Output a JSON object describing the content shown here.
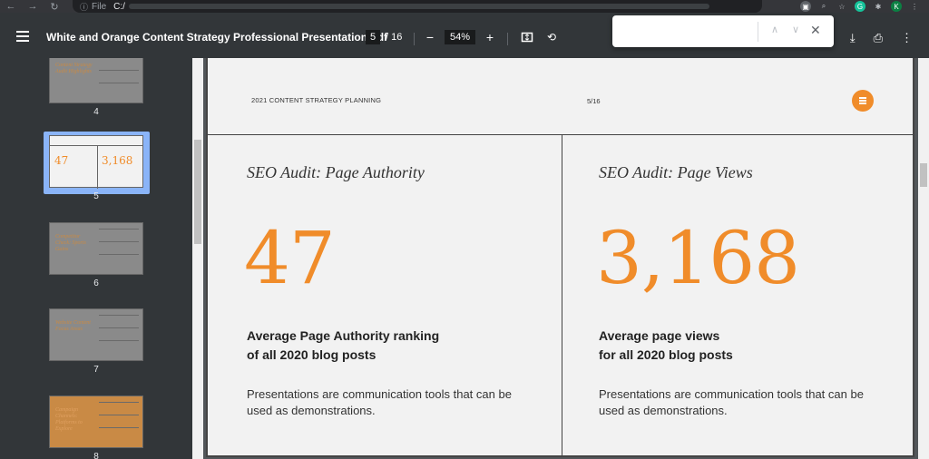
{
  "browser": {
    "file_label": "File",
    "url": "C:/",
    "ext_g": "G",
    "ext_avatar": "K"
  },
  "toolbar": {
    "title": "White and Orange Content Strategy Professional Presentation.pdf",
    "current_page": "5",
    "total_pages": "/ 16",
    "zoom": "54%",
    "zoom_out": "−",
    "zoom_in": "+"
  },
  "findbar": {
    "value": "",
    "up": "∧",
    "down": "∨",
    "close": "✕"
  },
  "sidebar": {
    "thumbnails": [
      {
        "num": "4",
        "color": "#8a8a8a",
        "accent": "#c98a45",
        "label": "Content Strategy Audit Highlights"
      },
      {
        "num": "5",
        "color": "#f2f2f2",
        "accent": "#f08c2a",
        "label": ""
      },
      {
        "num": "6",
        "color": "#8a8a8a",
        "accent": "#c98a45",
        "label": "Competitor Check: Sports Gains"
      },
      {
        "num": "7",
        "color": "#8a8a8a",
        "accent": "#c98a45",
        "label": "Website Content Focus Areas"
      },
      {
        "num": "8",
        "color": "#c98a45",
        "accent": "#e0a060",
        "label": "Campaign Channels: Platforms to Explore"
      }
    ]
  },
  "page": {
    "header_title": "2021 CONTENT STRATEGY PLANNING",
    "header_page": "5/16",
    "left": {
      "heading": "SEO Audit: Page Authority",
      "number": "47",
      "sub_line1": "Average Page Authority ranking",
      "sub_line2": "of all 2020 blog posts",
      "body_line1": "Presentations are communication tools that can be",
      "body_line2": "used as demonstrations."
    },
    "right": {
      "heading": "SEO Audit: Page Views",
      "number": "3,168",
      "sub_line1": "Average page views",
      "sub_line2": "for all 2020 blog posts",
      "body_line1": "Presentations are communication tools that can be",
      "body_line2": "used as demonstrations."
    }
  },
  "colors": {
    "accent": "#f08c2a",
    "toolbar_bg": "#323639",
    "viewport_bg": "#525659",
    "selection": "#8ab4f8"
  }
}
